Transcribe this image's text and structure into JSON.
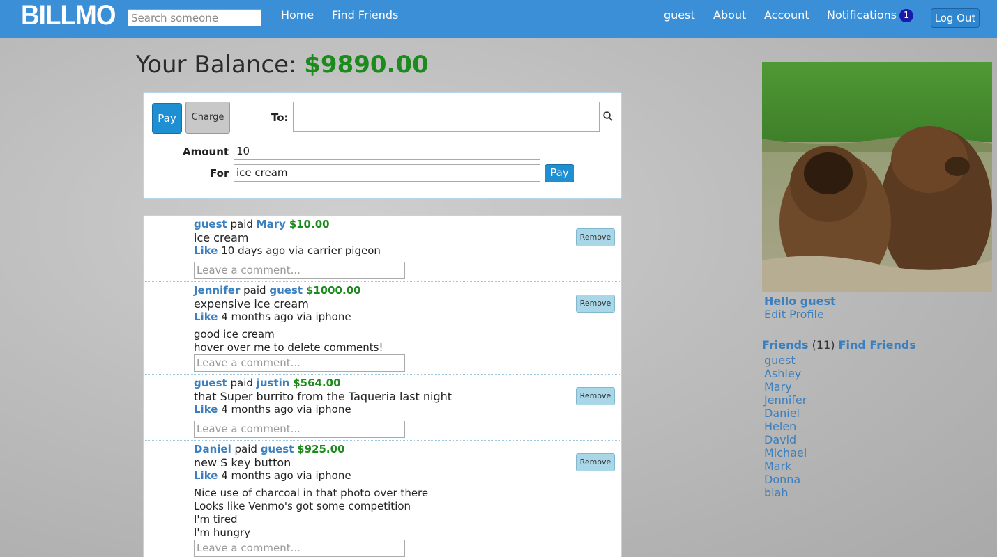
{
  "header": {
    "logo": "BILLMO",
    "search_placeholder": "Search someone",
    "nav_left": [
      "Home",
      "Find Friends"
    ],
    "nav_right": [
      "guest",
      "About",
      "Account"
    ],
    "notifications_label": "Notifications",
    "notifications_count": "1",
    "logout_label": "Log Out"
  },
  "balance": {
    "label": "Your Balance: ",
    "amount": "$9890.00"
  },
  "payment_form": {
    "pay_tab": "Pay",
    "charge_tab": "Charge",
    "to_label": "To:",
    "to_value": "",
    "amount_label": "Amount",
    "amount_value": "10",
    "for_label": "For",
    "for_value": "ice cream",
    "submit_label": "Pay"
  },
  "feed": {
    "comment_placeholder": "Leave a comment...",
    "remove_label": "Remove",
    "like_label": "Like",
    "paid_word": "paid",
    "items": [
      {
        "from": "guest",
        "to": "Mary",
        "amount": "$10.00",
        "note": "ice cream",
        "meta": "10 days ago via carrier pigeon",
        "comments": []
      },
      {
        "from": "Jennifer",
        "to": "guest",
        "amount": "$1000.00",
        "note": "expensive ice cream",
        "meta": "4 months ago via iphone",
        "comments": [
          "good ice cream",
          "hover over me to delete comments!"
        ]
      },
      {
        "from": "guest",
        "to": "justin",
        "amount": "$564.00",
        "note": "that Super burrito from the Taqueria last night",
        "meta": "4 months ago via iphone",
        "comments": []
      },
      {
        "from": "Daniel",
        "to": "guest",
        "amount": "$925.00",
        "note": "new S key button",
        "meta": "4 months ago via iphone",
        "comments": [
          "Nice use of charcoal in that photo over there",
          "Looks like Venmo's got some competition",
          "I'm tired",
          "I'm hungry"
        ]
      }
    ]
  },
  "sidebar": {
    "hello": "Hello guest",
    "edit_profile": "Edit Profile",
    "friends_label": "Friends",
    "friends_count": "(11)",
    "find_friends": "Find Friends",
    "friends": [
      "guest",
      "Ashley",
      "Mary",
      "Jennifer",
      "Daniel",
      "Helen",
      "David",
      "Michael",
      "Mark",
      "Donna",
      "blah"
    ]
  },
  "colors": {
    "brand": "#3a8fd6",
    "money": "#1c8a1c",
    "link": "#3a7fbf"
  }
}
